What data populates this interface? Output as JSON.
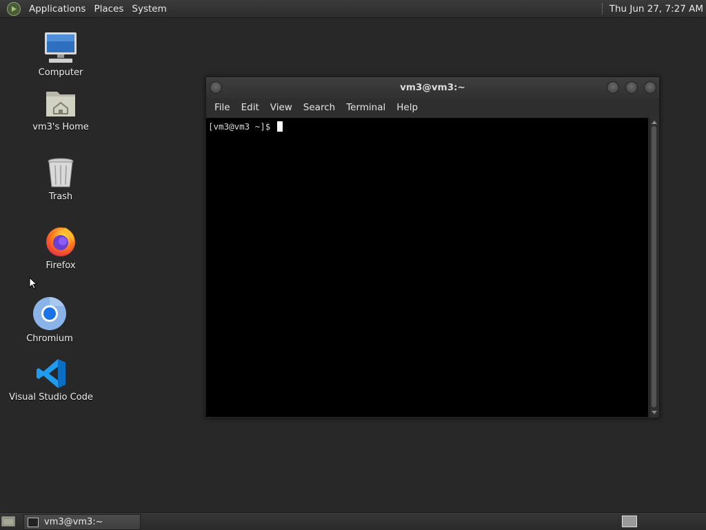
{
  "top_panel": {
    "menus": [
      "Applications",
      "Places",
      "System"
    ],
    "clock": "Thu Jun 27,  7:27 AM"
  },
  "desktop_icons": [
    {
      "label": "Computer",
      "icon": "computer-icon"
    },
    {
      "label": "vm3's Home",
      "icon": "home-folder-icon"
    },
    {
      "label": "Trash",
      "icon": "trash-icon"
    },
    {
      "label": "Firefox",
      "icon": "firefox-icon"
    },
    {
      "label": "Chromium",
      "icon": "chromium-icon"
    },
    {
      "label": "Visual Studio Code",
      "icon": "vscode-icon"
    }
  ],
  "terminal": {
    "title": "vm3@vm3:~",
    "menu": [
      "File",
      "Edit",
      "View",
      "Search",
      "Terminal",
      "Help"
    ],
    "prompt": "[vm3@vm3 ~]$ "
  },
  "bottom_panel": {
    "task_label": "vm3@vm3:~"
  }
}
